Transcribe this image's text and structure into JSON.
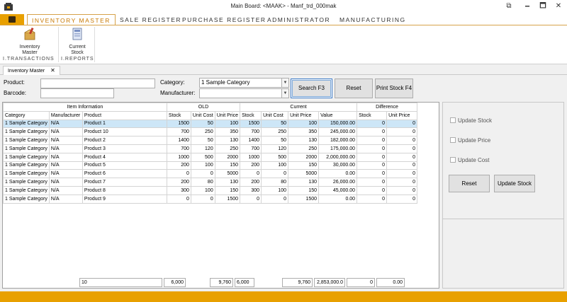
{
  "window": {
    "title": "Main Board: <MAAK> - Manf_trd_000mak",
    "minimize": "🗕",
    "maximize": "🗖",
    "close": "✕",
    "restore": "⧉"
  },
  "ribbon": {
    "tabs": [
      "INVENTORY MASTER",
      "SALE REGISTER",
      "PURCHASE REGISTER",
      "ADMINISTRATOR",
      "MANUFACTURING"
    ],
    "buttons": {
      "inventory_master": "Inventory Master",
      "current_stock": "Current Stock"
    },
    "groups": {
      "transactions": "I.TRANSACTIONS",
      "reports": "I.REPORTS"
    }
  },
  "doc_tab": {
    "label": "Inventory Master",
    "close": "✕"
  },
  "form": {
    "product_label": "Product:",
    "barcode_label": "Barcode:",
    "category_label": "Category:",
    "manufacturer_label": "Manufacturer:",
    "product_value": "",
    "barcode_value": "",
    "category_value": "1 Sample Category",
    "manufacturer_value": "",
    "search_button": "Search F3",
    "reset_button": "Reset",
    "print_button": "Print Stock F4"
  },
  "grid": {
    "groups": [
      "Item Information",
      "OLD",
      "Current",
      "Difference"
    ],
    "columns": [
      "Category",
      "Manufacturer",
      "Product",
      "Stock",
      "Unit Cost",
      "Unit Price",
      "Stock",
      "Unit Cost",
      "Unit Price",
      "Value",
      "Stock",
      "Unit Price"
    ],
    "rows": [
      [
        "1 Sample Category",
        "N/A",
        "Product 1",
        "1500",
        "50",
        "100",
        "1500",
        "50",
        "100",
        "150,000.00",
        "0",
        "0"
      ],
      [
        "1 Sample Category",
        "N/A",
        "Product 10",
        "700",
        "250",
        "350",
        "700",
        "250",
        "350",
        "245,000.00",
        "0",
        "0"
      ],
      [
        "1 Sample Category",
        "N/A",
        "Product 2",
        "1400",
        "50",
        "130",
        "1400",
        "50",
        "130",
        "182,000.00",
        "0",
        "0"
      ],
      [
        "1 Sample Category",
        "N/A",
        "Product 3",
        "700",
        "120",
        "250",
        "700",
        "120",
        "250",
        "175,000.00",
        "0",
        "0"
      ],
      [
        "1 Sample Category",
        "N/A",
        "Product 4",
        "1000",
        "500",
        "2000",
        "1000",
        "500",
        "2000",
        "2,000,000.00",
        "0",
        "0"
      ],
      [
        "1 Sample Category",
        "N/A",
        "Product 5",
        "200",
        "100",
        "150",
        "200",
        "100",
        "150",
        "30,000.00",
        "0",
        "0"
      ],
      [
        "1 Sample Category",
        "N/A",
        "Product 6",
        "0",
        "0",
        "5000",
        "0",
        "0",
        "5000",
        "0.00",
        "0",
        "0"
      ],
      [
        "1 Sample Category",
        "N/A",
        "Product 7",
        "200",
        "80",
        "130",
        "200",
        "80",
        "130",
        "26,000.00",
        "0",
        "0"
      ],
      [
        "1 Sample Category",
        "N/A",
        "Product 8",
        "300",
        "100",
        "150",
        "300",
        "100",
        "150",
        "45,000.00",
        "0",
        "0"
      ],
      [
        "1 Sample Category",
        "N/A",
        "Product 9",
        "0",
        "0",
        "1500",
        "0",
        "0",
        "1500",
        "0.00",
        "0",
        "0"
      ]
    ],
    "selected_row": 0
  },
  "totals": {
    "count": "10",
    "old_stock": "6,000",
    "old_unit_price": "9,760",
    "cur_stock": "6,000",
    "cur_unit_price": "9,760",
    "value": "2,853,000.0",
    "diff_stock": "0",
    "diff_price": "0.00"
  },
  "panel": {
    "update_stock": "Update Stock",
    "update_price": "Update Price",
    "update_cost": "Update Cost",
    "reset_button": "Reset",
    "update_stock_button": "Update Stock"
  },
  "colors": {
    "accent": "#e8a000",
    "selection": "#cde6f7"
  }
}
